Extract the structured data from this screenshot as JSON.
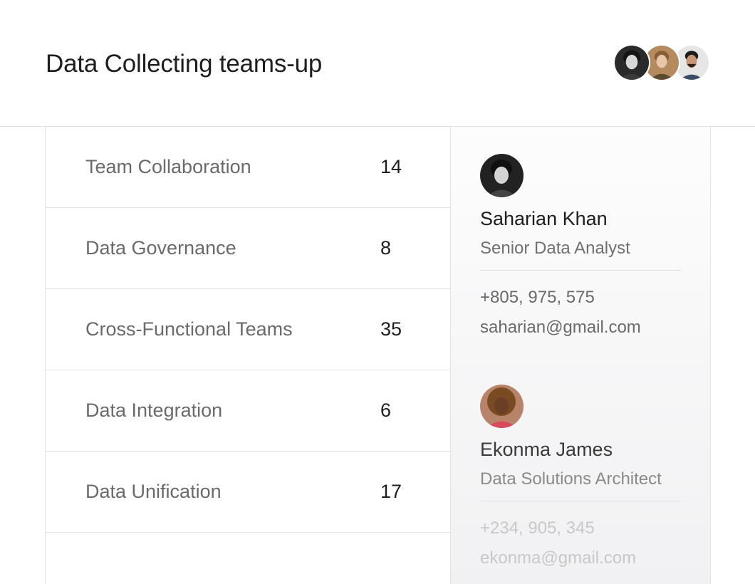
{
  "header": {
    "title": "Data Collecting teams-up",
    "avatars": [
      "avatar-1",
      "avatar-2",
      "avatar-3"
    ]
  },
  "categories": [
    {
      "label": "Team Collaboration",
      "count": "14"
    },
    {
      "label": "Data Governance",
      "count": "8"
    },
    {
      "label": "Cross-Functional Teams",
      "count": "35"
    },
    {
      "label": "Data Integration",
      "count": "6"
    },
    {
      "label": "Data Unification",
      "count": "17"
    }
  ],
  "contacts": [
    {
      "name": "Saharian Khan",
      "role": "Senior Data Analyst",
      "phone": "+805, 975, 575",
      "email": "saharian@gmail.com"
    },
    {
      "name": "Ekonma James",
      "role": "Data Solutions Architect",
      "phone": "+234, 905, 345",
      "email": "ekonma@gmail.com"
    }
  ]
}
